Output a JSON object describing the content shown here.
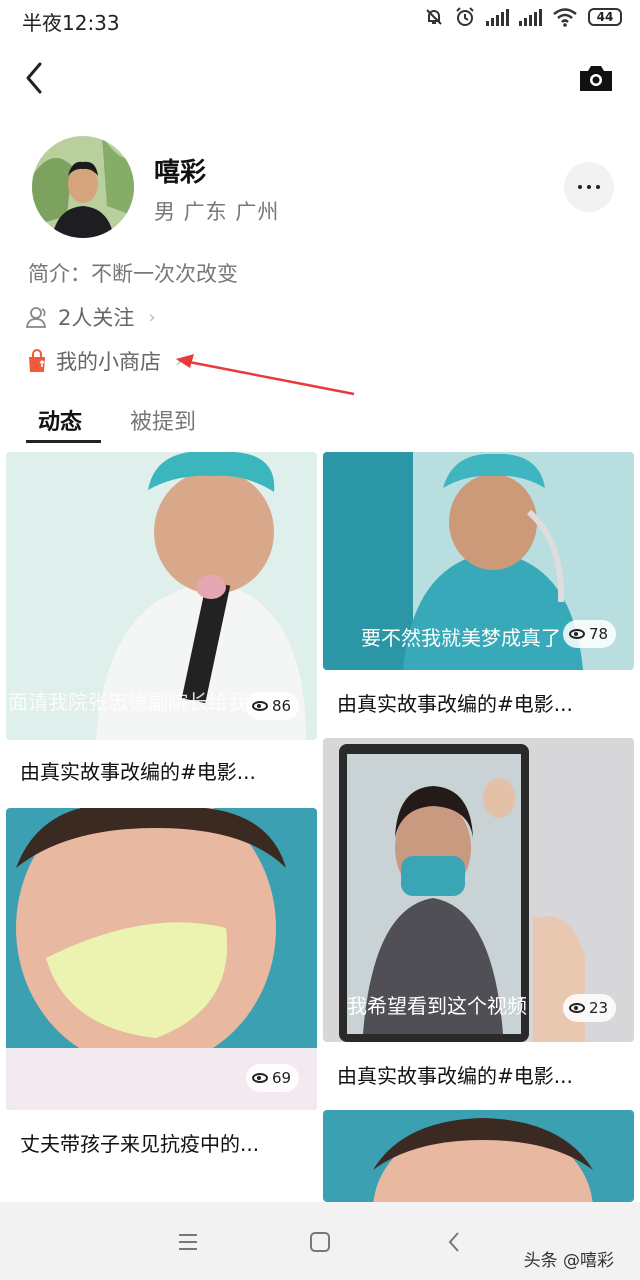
{
  "status": {
    "time": "半夜12:33",
    "battery": "44"
  },
  "profile": {
    "name": "嘻彩",
    "meta": "男  广东  广州",
    "bio": "简介：不断一次次改变",
    "followers": "2人关注",
    "shop": "我的小商店"
  },
  "tabs": [
    "动态",
    "被提到"
  ],
  "cards": [
    {
      "caption": "由真实故事改编的#电影...",
      "views": "86",
      "subtitle": "面请我院张忠德副院长给我家"
    },
    {
      "caption": "由真实故事改编的#电影...",
      "views": "78",
      "subtitle": "要不然我就美梦成真了"
    },
    {
      "caption": "由真实故事改编的#电影...",
      "views": "23",
      "subtitle": "我希望看到这个视频"
    },
    {
      "caption": "丈夫带孩子来见抗疫中的...",
      "views": "69"
    }
  ],
  "watermark": "头条 @嘻彩",
  "colors": {
    "accent_shop": "#f05a3a",
    "annotation_red": "#e83a3a",
    "background": "#ffffff"
  },
  "icons": [
    "back-icon",
    "camera-icon",
    "more-icon",
    "person-icon",
    "shop-bag-icon",
    "eye-icon",
    "menu-icon",
    "home-icon",
    "back-nav-icon"
  ]
}
